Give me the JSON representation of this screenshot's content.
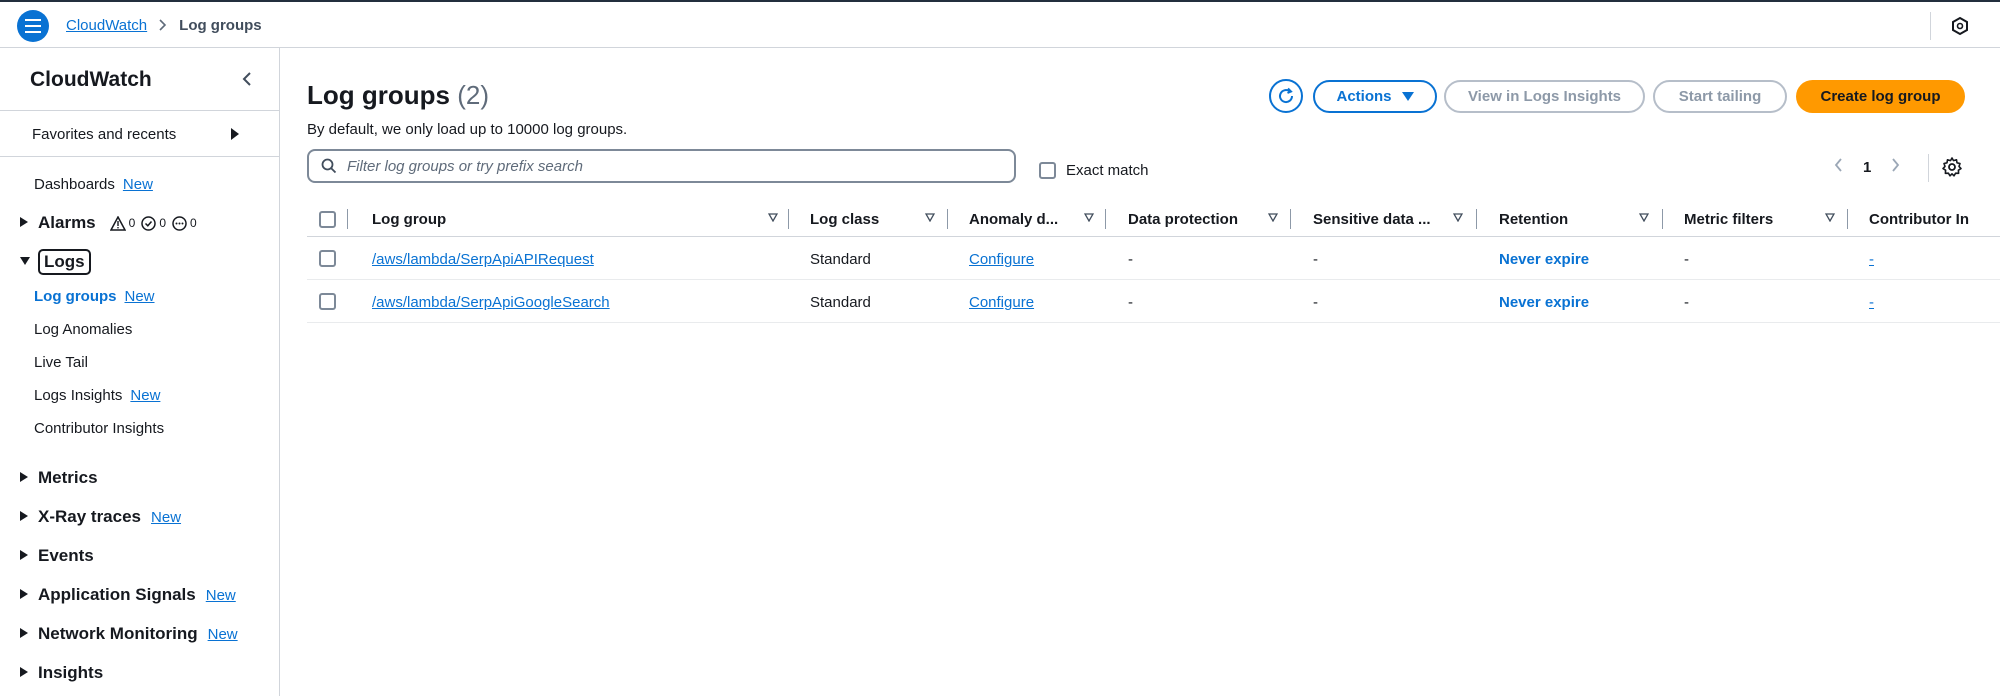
{
  "topbar": {
    "breadcrumb_root": "CloudWatch",
    "breadcrumb_current": "Log groups"
  },
  "sidebar": {
    "title": "CloudWatch",
    "favorites": "Favorites and recents",
    "dashboards": "Dashboards",
    "new_label": "New",
    "alarms": {
      "label": "Alarms",
      "alarm_count": "0",
      "ok_count": "0",
      "insufficient_count": "0"
    },
    "logs": {
      "label": "Logs",
      "items": [
        {
          "label": "Log groups",
          "new": "New",
          "active": true
        },
        {
          "label": "Log Anomalies"
        },
        {
          "label": "Live Tail"
        },
        {
          "label": "Logs Insights",
          "new": "New"
        },
        {
          "label": "Contributor Insights"
        }
      ]
    },
    "sections": [
      {
        "label": "Metrics"
      },
      {
        "label": "X-Ray traces",
        "new": "New"
      },
      {
        "label": "Events"
      },
      {
        "label": "Application Signals",
        "new": "New"
      },
      {
        "label": "Network Monitoring",
        "new": "New"
      },
      {
        "label": "Insights"
      }
    ]
  },
  "main": {
    "title": "Log groups",
    "count": "(2)",
    "subtitle": "By default, we only load up to 10000 log groups.",
    "buttons": {
      "actions": "Actions",
      "view_logs_insights": "View in Logs Insights",
      "start_tailing": "Start tailing",
      "create_log_group": "Create log group"
    },
    "search_placeholder": "Filter log groups or try prefix search",
    "exact_match": "Exact match",
    "page": "1"
  },
  "table": {
    "columns": [
      "Log group",
      "Log class",
      "Anomaly d...",
      "Data protection",
      "Sensitive data ...",
      "Retention",
      "Metric filters",
      "Contributor In"
    ],
    "rows": [
      {
        "log_group": "/aws/lambda/SerpApiAPIRequest",
        "log_class": "Standard",
        "anomaly": "Configure",
        "data_protection": "-",
        "sensitive": "-",
        "retention": "Never expire",
        "metric_filters": "-",
        "contributor": "-"
      },
      {
        "log_group": "/aws/lambda/SerpApiGoogleSearch",
        "log_class": "Standard",
        "anomaly": "Configure",
        "data_protection": "-",
        "sensitive": "-",
        "retention": "Never expire",
        "metric_filters": "-",
        "contributor": "-"
      }
    ]
  },
  "colors": {
    "link": "#0972d3",
    "primary_button": "#ff9900",
    "disabled": "#8d99a8"
  }
}
